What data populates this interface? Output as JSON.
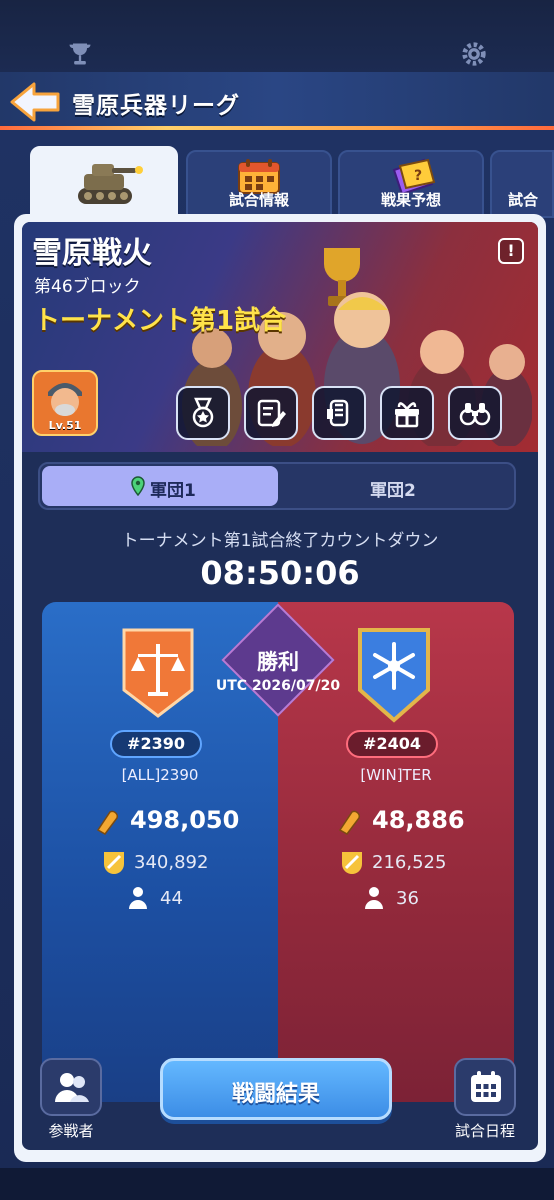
{
  "header": {
    "title": "雪原兵器リーグ"
  },
  "tabs": [
    {
      "label": ""
    },
    {
      "label": "試合情報"
    },
    {
      "label": "戦果予想"
    },
    {
      "label": "試合"
    }
  ],
  "banner": {
    "title": "雪原戦火",
    "block": "第46ブロック",
    "match": "トーナメント第1試合",
    "info": "!",
    "avatar_level": "Lv.51"
  },
  "segments": {
    "team1": "軍団1",
    "team2": "軍団2"
  },
  "countdown": {
    "label": "トーナメント第1試合終了カウントダウン",
    "time": "08:50:06"
  },
  "result": {
    "label": "勝利",
    "date": "UTC 2026/07/20"
  },
  "left": {
    "rank": "#2390",
    "alliance": "[ALL]2390",
    "points": "498,050",
    "power": "340,892",
    "members": "44"
  },
  "right": {
    "rank": "#2404",
    "alliance": "[WIN]TER",
    "points": "48,886",
    "power": "216,525",
    "members": "36"
  },
  "buttons": {
    "battle_result": "戦闘結果",
    "participants": "参戦者",
    "schedule": "試合日程"
  },
  "colors": {
    "blue_side": "#1c4fa2",
    "red_side": "#92293b",
    "accent_gold": "#ffe34a"
  }
}
